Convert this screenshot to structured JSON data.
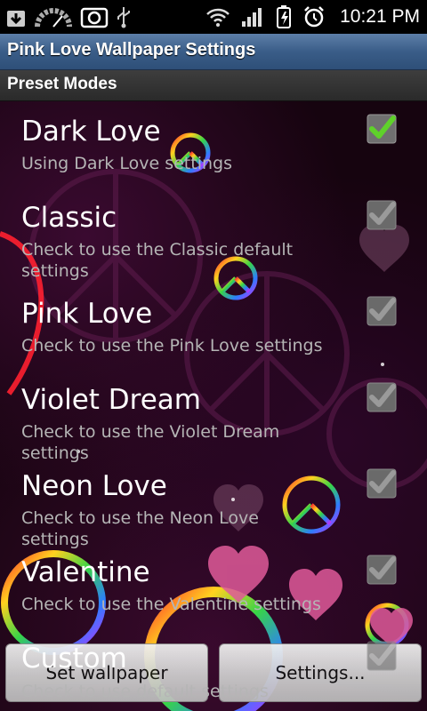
{
  "status_bar": {
    "time": "10:21 PM",
    "icons": [
      "download-icon",
      "gauge-icon",
      "camera-icon",
      "usb-icon",
      "wifi-icon",
      "signal-icon",
      "charging-icon",
      "alarm-icon"
    ]
  },
  "header": {
    "title": "Pink Love Wallpaper Settings"
  },
  "category": {
    "title": "Preset Modes"
  },
  "presets": [
    {
      "title": "Dark Love",
      "summary": "Using Dark Love settings",
      "checked": true
    },
    {
      "title": "Classic",
      "summary": "Check to use the Classic default settings",
      "checked": false
    },
    {
      "title": "Pink Love",
      "summary": "Check to use the Pink Love settings",
      "checked": false
    },
    {
      "title": "Violet Dream",
      "summary": "Check to use the Violet Dream settings",
      "checked": false
    },
    {
      "title": "Neon Love",
      "summary": "Check to use the Neon Love settings",
      "checked": false
    },
    {
      "title": "Valentine",
      "summary": "Check to use the Valentine settings",
      "checked": false
    },
    {
      "title": "Custom",
      "summary": "Check to use default settings",
      "checked": false
    }
  ],
  "buttons": {
    "set_wallpaper": "Set wallpaper",
    "settings": "Settings..."
  },
  "colors": {
    "title_bar": "#3a5d88",
    "check_green": "#5fd12a",
    "text": "#ffffff",
    "summary": "#b5b5b5"
  }
}
